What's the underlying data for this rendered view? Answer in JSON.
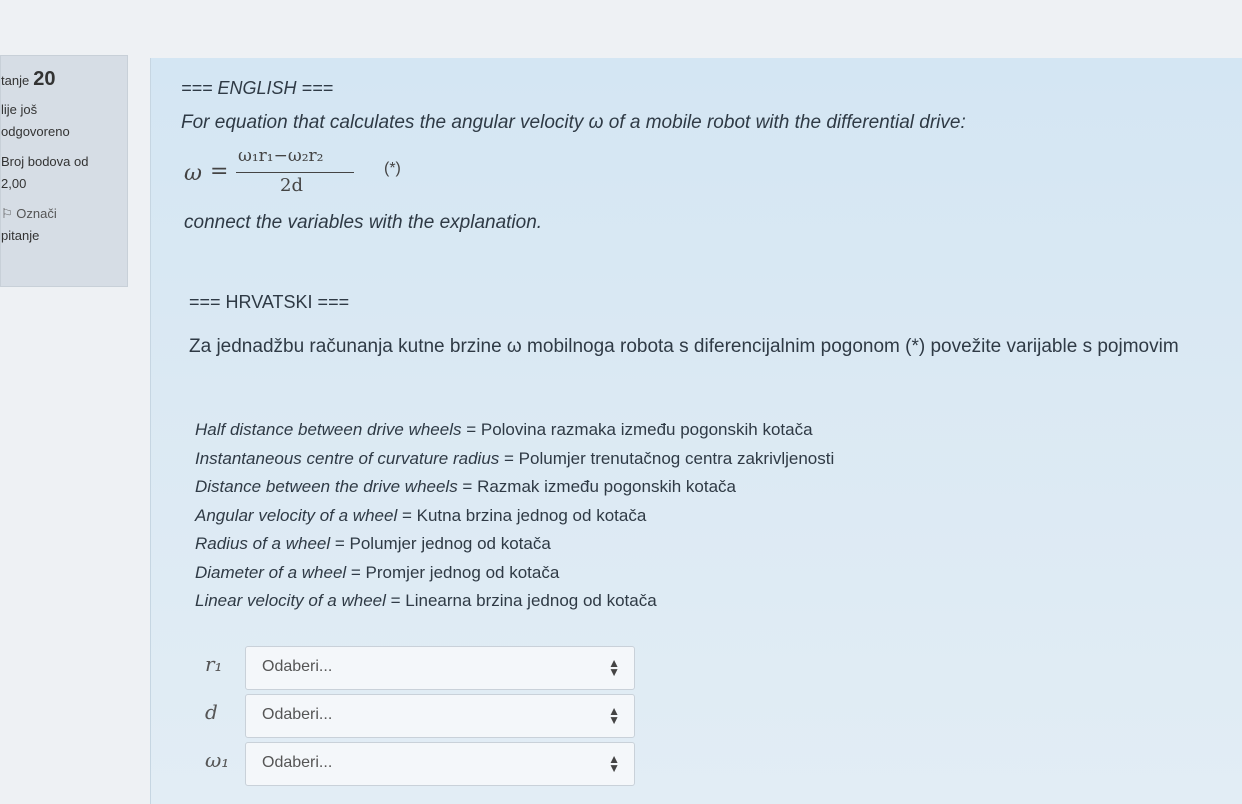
{
  "info": {
    "question_label": "tanje",
    "question_number": "20",
    "status_line1": "lije još",
    "status_line2": "odgovoreno",
    "points_line1": "Broj bodova od",
    "points_line2": "2,00",
    "flag_line1": "Označi",
    "flag_line2": "pitanje"
  },
  "question": {
    "english_heading": "=== ENGLISH ===",
    "english_text": "For equation that calculates the angular velocity ω of a mobile robot with the differential drive:",
    "formula": {
      "lhs": "ω",
      "eq": "=",
      "numerator": "ω₁r₁−ω₂r₂",
      "denominator": "2d",
      "marker": "(*)"
    },
    "english_instruction": "connect the variables with the explanation.",
    "croatian_heading": "=== HRVATSKI ===",
    "croatian_text": "Za jednadžbu računanja kutne brzine ω mobilnoga robota s diferencijalnim pogonom (*) povežite varijable s pojmovim"
  },
  "glossary": [
    {
      "en": "Half distance between drive wheels",
      "hr": " = Polovina razmaka između pogonskih kotača"
    },
    {
      "en": "Instantaneous centre of curvature radius",
      "hr": " = Polumjer trenutačnog centra zakrivljenosti"
    },
    {
      "en": "Distance between the drive wheels",
      "hr": " = Razmak između pogonskih kotača"
    },
    {
      "en": "Angular velocity of a wheel",
      "hr": " = Kutna brzina jednog od kotača"
    },
    {
      "en": "Radius of a wheel",
      "hr": " = Polumjer jednog od kotača"
    },
    {
      "en": "Diameter of a wheel",
      "hr": " = Promjer jednog od kotača"
    },
    {
      "en": "Linear velocity of a wheel",
      "hr": " = Linearna brzina jednog od kotača"
    }
  ],
  "matches": [
    {
      "variable": "r₁",
      "selected": "Odaberi..."
    },
    {
      "variable": "d",
      "selected": "Odaberi..."
    },
    {
      "variable": "ω₁",
      "selected": "Odaberi..."
    }
  ],
  "icons": {
    "flag": "flag-icon",
    "select_caret": "up-down-caret-icon"
  }
}
